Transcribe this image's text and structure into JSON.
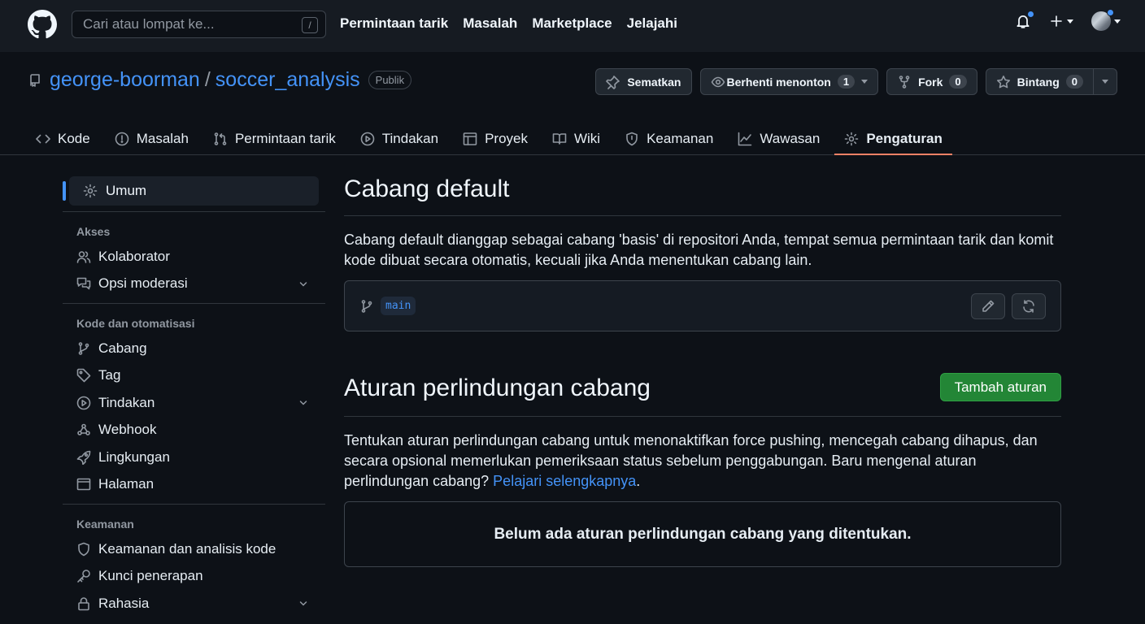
{
  "header": {
    "search_placeholder": "Cari atau lompat ke...",
    "search_shortcut": "/",
    "nav": [
      "Permintaan tarik",
      "Masalah",
      "Marketplace",
      "Jelajahi"
    ]
  },
  "repo": {
    "owner": "george-boorman",
    "separator": "/",
    "name": "soccer_analysis",
    "visibility": "Publik",
    "actions": {
      "pin": "Sematkan",
      "watch": "Berhenti menonton",
      "watch_count": "1",
      "fork": "Fork",
      "fork_count": "0",
      "star": "Bintang",
      "star_count": "0"
    },
    "tabs": [
      "Kode",
      "Masalah",
      "Permintaan tarik",
      "Tindakan",
      "Proyek",
      "Wiki",
      "Keamanan",
      "Wawasan",
      "Pengaturan"
    ]
  },
  "sidebar": {
    "active": "Umum",
    "sections": [
      {
        "heading": "Akses",
        "items": [
          "Kolaborator",
          "Opsi moderasi"
        ]
      },
      {
        "heading": "Kode dan otomatisasi",
        "items": [
          "Cabang",
          "Tag",
          "Tindakan",
          "Webhook",
          "Lingkungan",
          "Halaman"
        ]
      },
      {
        "heading": "Keamanan",
        "items": [
          "Keamanan dan analisis kode",
          "Kunci penerapan",
          "Rahasia"
        ]
      }
    ]
  },
  "main": {
    "default_branch": {
      "title": "Cabang default",
      "description": "Cabang default dianggap sebagai cabang 'basis' di repositori Anda, tempat semua permintaan tarik dan komit kode dibuat secara otomatis, kecuali jika Anda menentukan cabang lain.",
      "branch": "main"
    },
    "protection": {
      "title": "Aturan perlindungan cabang",
      "add_button": "Tambah aturan",
      "description": "Tentukan aturan perlindungan cabang untuk menonaktifkan force pushing, mencegah cabang dihapus, dan secara opsional memerlukan pemeriksaan status sebelum penggabungan. Baru mengenal aturan perlindungan cabang?",
      "learn_more": "Pelajari selengkapnya",
      "period": ".",
      "empty": "Belum ada aturan perlindungan cabang yang ditentukan."
    }
  },
  "colors": {
    "accent": "#4493f8",
    "active_tab_underline": "#f78166",
    "primary_button": "#238636"
  }
}
